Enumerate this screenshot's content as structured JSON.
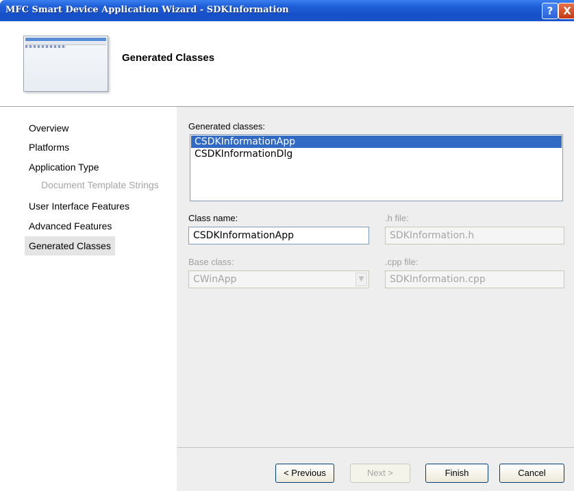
{
  "window": {
    "title": "MFC Smart Device Application Wizard - SDKInformation",
    "help_label": "?",
    "close_label": "X"
  },
  "header": {
    "heading": "Generated Classes"
  },
  "sidebar": {
    "items": [
      {
        "label": "Overview"
      },
      {
        "label": "Platforms"
      },
      {
        "label": "Application Type"
      },
      {
        "label": "Document Template Strings"
      },
      {
        "label": "User Interface Features"
      },
      {
        "label": "Advanced Features"
      },
      {
        "label": "Generated Classes"
      }
    ]
  },
  "main": {
    "generated_classes_label": "Generated classes:",
    "classes": [
      "CSDKInformationApp",
      "CSDKInformationDlg"
    ],
    "class_name_label": "Class name:",
    "class_name_value": "CSDKInformationApp",
    "h_file_label": ".h file:",
    "h_file_value": "SDKInformation.h",
    "base_class_label": "Base class:",
    "base_class_value": "CWinApp",
    "cpp_file_label": ".cpp file:",
    "cpp_file_value": "SDKInformation.cpp"
  },
  "buttons": {
    "previous": "< Previous",
    "next": "Next >",
    "finish": "Finish",
    "cancel": "Cancel"
  }
}
